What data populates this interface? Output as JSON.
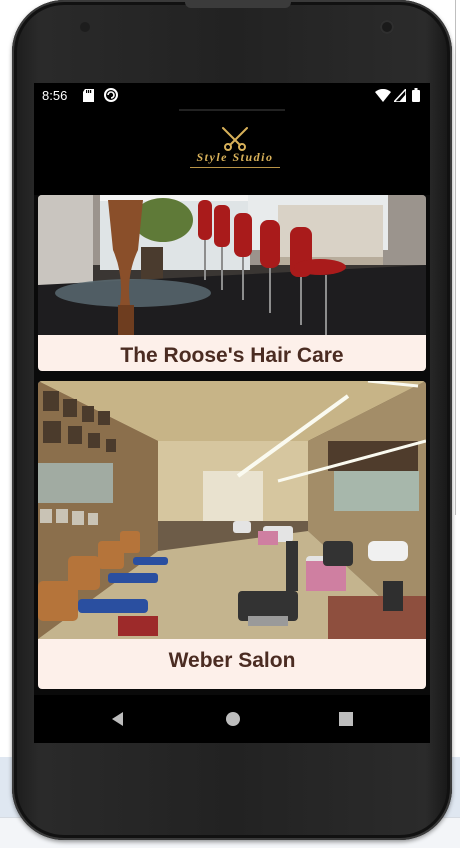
{
  "status_bar": {
    "time": "8:56",
    "icons": [
      "sd-card-icon",
      "sync-circle-icon",
      "wifi-icon",
      "signal-icon",
      "battery-icon"
    ]
  },
  "app": {
    "logo_text": "Style Studio",
    "logo_icon": "scissors-comb-icon",
    "accent": "#d8b15a"
  },
  "salons": [
    {
      "name": "The Roose's Hair Care",
      "image": "modern salon interior with red bar stools"
    },
    {
      "name": "Weber Salon",
      "image": "vintage barbershop interior with barber chairs"
    }
  ],
  "nav": {
    "icons": [
      "back-triangle-icon",
      "home-circle-icon",
      "recents-square-icon"
    ]
  },
  "colors": {
    "card_background": "#fdf0ea",
    "card_title": "#4b2c22",
    "app_background": "#000000"
  }
}
